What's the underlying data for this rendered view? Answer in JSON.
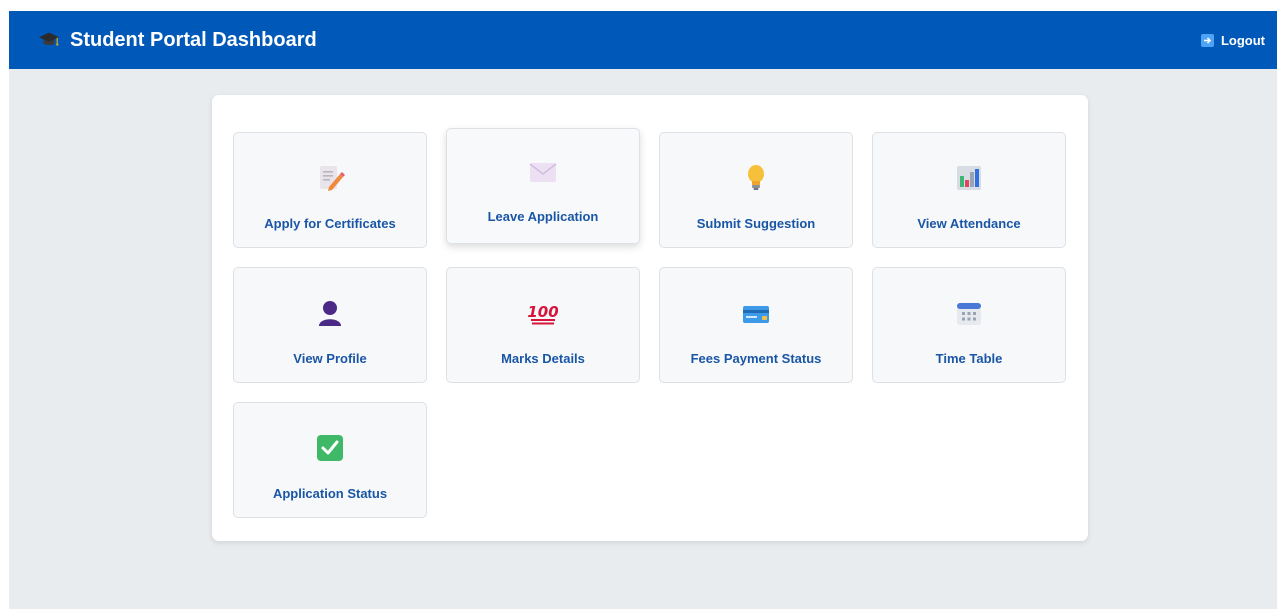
{
  "header": {
    "title": "Student Portal Dashboard",
    "logout_label": "Logout",
    "brand_icon": "graduation-cap-icon",
    "logout_icon": "logout-arrow-icon",
    "bar_color": "#0059b8"
  },
  "tiles": [
    {
      "label": "Apply for Certificates",
      "icon": "memo-pencil-icon"
    },
    {
      "label": "Leave Application",
      "icon": "envelope-icon"
    },
    {
      "label": "Submit Suggestion",
      "icon": "light-bulb-icon"
    },
    {
      "label": "View Attendance",
      "icon": "bar-chart-icon"
    },
    {
      "label": "View Profile",
      "icon": "person-silhouette-icon"
    },
    {
      "label": "Marks Details",
      "icon": "hundred-points-icon"
    },
    {
      "label": "Fees Payment Status",
      "icon": "credit-card-icon"
    },
    {
      "label": "Time Table",
      "icon": "calendar-icon"
    },
    {
      "label": "Application Status",
      "icon": "check-mark-button-icon"
    }
  ],
  "colors": {
    "accent": "#0059b8",
    "tile_label": "#1a56a6",
    "page_bg": "#e9ecef"
  }
}
